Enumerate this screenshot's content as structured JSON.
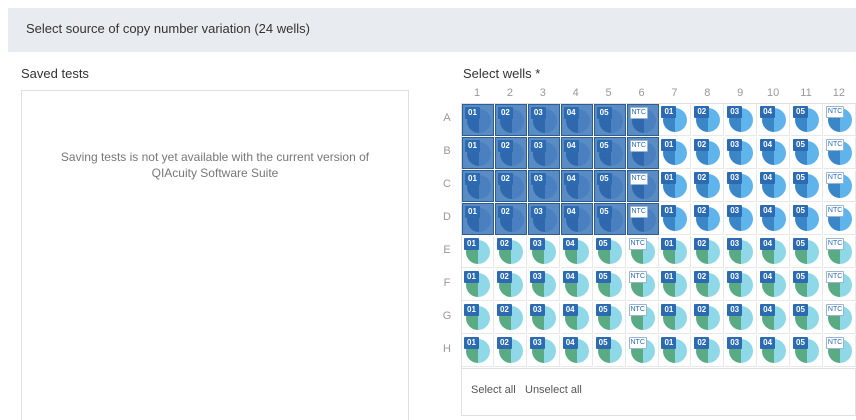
{
  "header": {
    "title": "Select source of copy number variation (24 wells)"
  },
  "saved_tests": {
    "label": "Saved tests",
    "message": "Saving tests is not yet available with the current version of QIAcuity Software Suite"
  },
  "wells": {
    "label": "Select wells *",
    "columns": [
      "1",
      "2",
      "3",
      "4",
      "5",
      "6",
      "7",
      "8",
      "9",
      "10",
      "11",
      "12"
    ],
    "rows": [
      "A",
      "B",
      "C",
      "D",
      "E",
      "F",
      "G",
      "H"
    ],
    "tag_labels": [
      "01",
      "02",
      "03",
      "04",
      "05",
      "NTC",
      "01",
      "02",
      "03",
      "04",
      "05",
      "NTC"
    ],
    "selected_rows": [
      "A",
      "B",
      "C",
      "D"
    ],
    "selected_columns": [
      "1",
      "2",
      "3",
      "4",
      "5",
      "6"
    ],
    "colors": {
      "top_light": "#5fb4ec",
      "top_dark": "#3b86c6",
      "bottom_light": "#8fd8e8",
      "bottom_dark": "#5aaa84",
      "selected_bg": "#5a8cc4",
      "tag_bg": "#2c6ab1"
    }
  },
  "footer": {
    "select_all": "Select all",
    "unselect_all": "Unselect all"
  }
}
